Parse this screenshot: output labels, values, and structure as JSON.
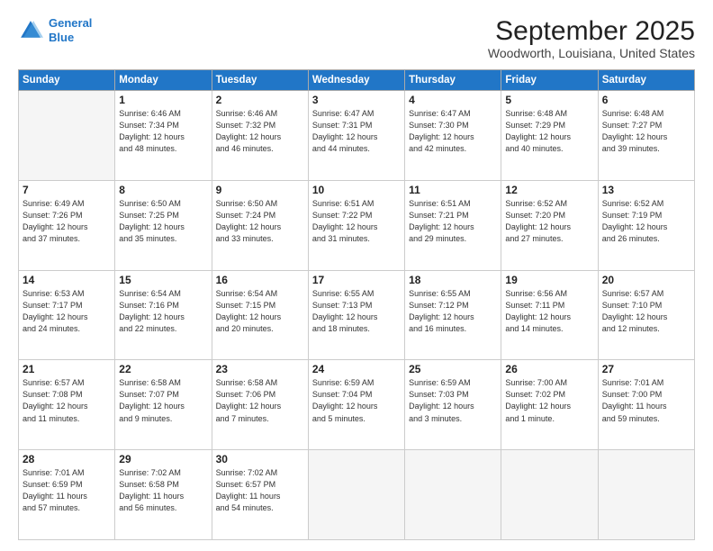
{
  "header": {
    "logo_line1": "General",
    "logo_line2": "Blue",
    "month": "September 2025",
    "location": "Woodworth, Louisiana, United States"
  },
  "weekdays": [
    "Sunday",
    "Monday",
    "Tuesday",
    "Wednesday",
    "Thursday",
    "Friday",
    "Saturday"
  ],
  "weeks": [
    [
      {
        "day": "",
        "info": ""
      },
      {
        "day": "1",
        "info": "Sunrise: 6:46 AM\nSunset: 7:34 PM\nDaylight: 12 hours\nand 48 minutes."
      },
      {
        "day": "2",
        "info": "Sunrise: 6:46 AM\nSunset: 7:32 PM\nDaylight: 12 hours\nand 46 minutes."
      },
      {
        "day": "3",
        "info": "Sunrise: 6:47 AM\nSunset: 7:31 PM\nDaylight: 12 hours\nand 44 minutes."
      },
      {
        "day": "4",
        "info": "Sunrise: 6:47 AM\nSunset: 7:30 PM\nDaylight: 12 hours\nand 42 minutes."
      },
      {
        "day": "5",
        "info": "Sunrise: 6:48 AM\nSunset: 7:29 PM\nDaylight: 12 hours\nand 40 minutes."
      },
      {
        "day": "6",
        "info": "Sunrise: 6:48 AM\nSunset: 7:27 PM\nDaylight: 12 hours\nand 39 minutes."
      }
    ],
    [
      {
        "day": "7",
        "info": "Sunrise: 6:49 AM\nSunset: 7:26 PM\nDaylight: 12 hours\nand 37 minutes."
      },
      {
        "day": "8",
        "info": "Sunrise: 6:50 AM\nSunset: 7:25 PM\nDaylight: 12 hours\nand 35 minutes."
      },
      {
        "day": "9",
        "info": "Sunrise: 6:50 AM\nSunset: 7:24 PM\nDaylight: 12 hours\nand 33 minutes."
      },
      {
        "day": "10",
        "info": "Sunrise: 6:51 AM\nSunset: 7:22 PM\nDaylight: 12 hours\nand 31 minutes."
      },
      {
        "day": "11",
        "info": "Sunrise: 6:51 AM\nSunset: 7:21 PM\nDaylight: 12 hours\nand 29 minutes."
      },
      {
        "day": "12",
        "info": "Sunrise: 6:52 AM\nSunset: 7:20 PM\nDaylight: 12 hours\nand 27 minutes."
      },
      {
        "day": "13",
        "info": "Sunrise: 6:52 AM\nSunset: 7:19 PM\nDaylight: 12 hours\nand 26 minutes."
      }
    ],
    [
      {
        "day": "14",
        "info": "Sunrise: 6:53 AM\nSunset: 7:17 PM\nDaylight: 12 hours\nand 24 minutes."
      },
      {
        "day": "15",
        "info": "Sunrise: 6:54 AM\nSunset: 7:16 PM\nDaylight: 12 hours\nand 22 minutes."
      },
      {
        "day": "16",
        "info": "Sunrise: 6:54 AM\nSunset: 7:15 PM\nDaylight: 12 hours\nand 20 minutes."
      },
      {
        "day": "17",
        "info": "Sunrise: 6:55 AM\nSunset: 7:13 PM\nDaylight: 12 hours\nand 18 minutes."
      },
      {
        "day": "18",
        "info": "Sunrise: 6:55 AM\nSunset: 7:12 PM\nDaylight: 12 hours\nand 16 minutes."
      },
      {
        "day": "19",
        "info": "Sunrise: 6:56 AM\nSunset: 7:11 PM\nDaylight: 12 hours\nand 14 minutes."
      },
      {
        "day": "20",
        "info": "Sunrise: 6:57 AM\nSunset: 7:10 PM\nDaylight: 12 hours\nand 12 minutes."
      }
    ],
    [
      {
        "day": "21",
        "info": "Sunrise: 6:57 AM\nSunset: 7:08 PM\nDaylight: 12 hours\nand 11 minutes."
      },
      {
        "day": "22",
        "info": "Sunrise: 6:58 AM\nSunset: 7:07 PM\nDaylight: 12 hours\nand 9 minutes."
      },
      {
        "day": "23",
        "info": "Sunrise: 6:58 AM\nSunset: 7:06 PM\nDaylight: 12 hours\nand 7 minutes."
      },
      {
        "day": "24",
        "info": "Sunrise: 6:59 AM\nSunset: 7:04 PM\nDaylight: 12 hours\nand 5 minutes."
      },
      {
        "day": "25",
        "info": "Sunrise: 6:59 AM\nSunset: 7:03 PM\nDaylight: 12 hours\nand 3 minutes."
      },
      {
        "day": "26",
        "info": "Sunrise: 7:00 AM\nSunset: 7:02 PM\nDaylight: 12 hours\nand 1 minute."
      },
      {
        "day": "27",
        "info": "Sunrise: 7:01 AM\nSunset: 7:00 PM\nDaylight: 11 hours\nand 59 minutes."
      }
    ],
    [
      {
        "day": "28",
        "info": "Sunrise: 7:01 AM\nSunset: 6:59 PM\nDaylight: 11 hours\nand 57 minutes."
      },
      {
        "day": "29",
        "info": "Sunrise: 7:02 AM\nSunset: 6:58 PM\nDaylight: 11 hours\nand 56 minutes."
      },
      {
        "day": "30",
        "info": "Sunrise: 7:02 AM\nSunset: 6:57 PM\nDaylight: 11 hours\nand 54 minutes."
      },
      {
        "day": "",
        "info": ""
      },
      {
        "day": "",
        "info": ""
      },
      {
        "day": "",
        "info": ""
      },
      {
        "day": "",
        "info": ""
      }
    ]
  ]
}
